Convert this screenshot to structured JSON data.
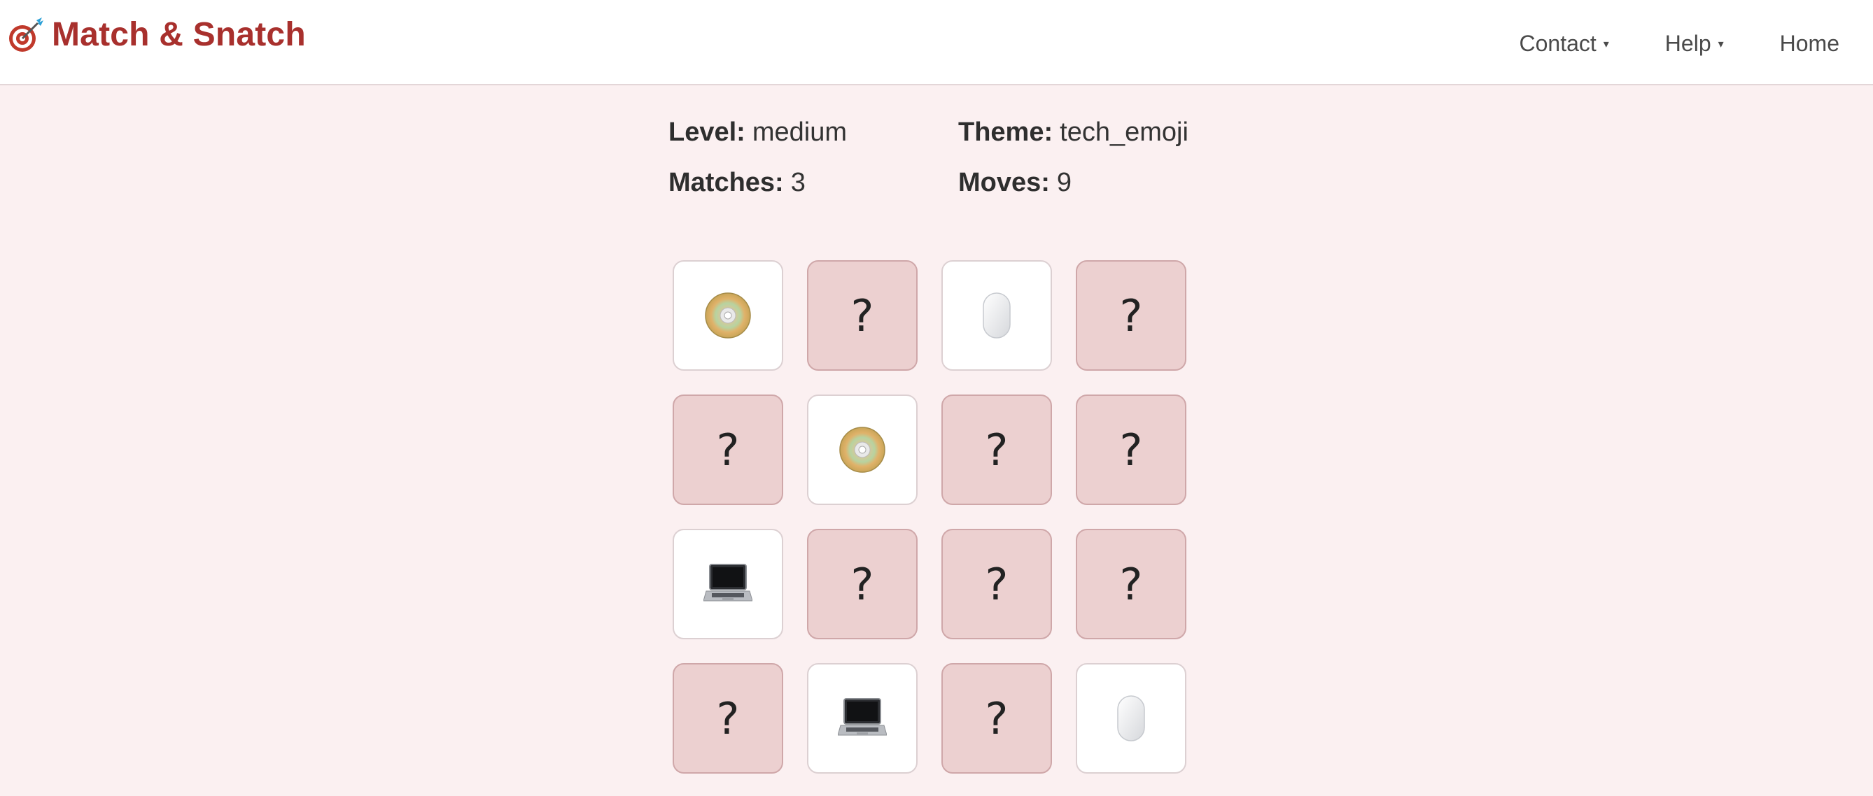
{
  "app": {
    "title": "Match & Snatch",
    "brand_icon": "target-dart-icon"
  },
  "nav": {
    "items": [
      {
        "label": "Contact",
        "has_dropdown": true
      },
      {
        "label": "Help",
        "has_dropdown": true
      },
      {
        "label": "Home",
        "has_dropdown": false
      }
    ],
    "caret": "▾"
  },
  "stats": {
    "level_label": "Level:",
    "level_value": "medium",
    "theme_label": "Theme:",
    "theme_value": "tech_emoji",
    "matches_label": "Matches:",
    "matches_value": "3",
    "moves_label": "Moves:",
    "moves_value": "9"
  },
  "board": {
    "rows": 4,
    "cols": 4,
    "hidden_symbol": "?",
    "cards": [
      {
        "state": "revealed",
        "icon": "cd-disc-icon"
      },
      {
        "state": "hidden"
      },
      {
        "state": "revealed",
        "icon": "computer-mouse-icon"
      },
      {
        "state": "hidden"
      },
      {
        "state": "hidden"
      },
      {
        "state": "revealed",
        "icon": "cd-disc-icon"
      },
      {
        "state": "hidden"
      },
      {
        "state": "hidden"
      },
      {
        "state": "revealed",
        "icon": "laptop-icon"
      },
      {
        "state": "hidden"
      },
      {
        "state": "hidden"
      },
      {
        "state": "hidden"
      },
      {
        "state": "hidden"
      },
      {
        "state": "revealed",
        "icon": "laptop-icon"
      },
      {
        "state": "hidden"
      },
      {
        "state": "revealed",
        "icon": "computer-mouse-icon"
      }
    ]
  },
  "colors": {
    "brand": "#a8302d",
    "page_bg": "#fbf0f1",
    "card_hidden": "#ecd0d0",
    "card_revealed": "#ffffff"
  }
}
